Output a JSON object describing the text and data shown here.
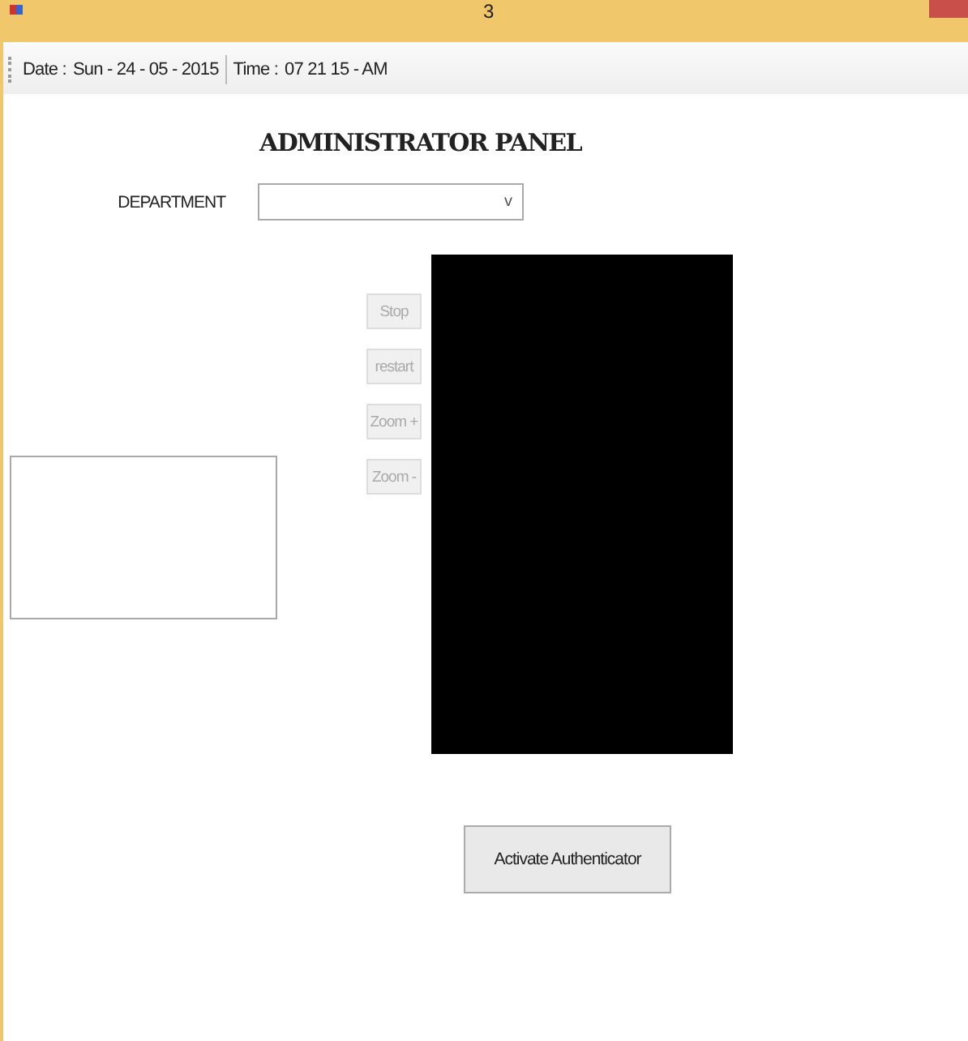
{
  "window": {
    "title": "3"
  },
  "status_bar": {
    "date_label": "Date :",
    "date": "Sun - 24 - 05 - 2015",
    "time_label": "Time :",
    "time": "07  21  15 - AM"
  },
  "heading": "ADMINISTRATOR PANEL",
  "department": {
    "label": "DEPARTMENT",
    "value_arrow": "v"
  },
  "camera_buttons": [
    {
      "label": "Stop",
      "disabled": true
    },
    {
      "label": "restart",
      "disabled": true
    },
    {
      "label": "Zoom +",
      "disabled": true
    },
    {
      "label": "Zoom -",
      "disabled": true
    }
  ],
  "activate_button": {
    "label": "Activate Authenticator",
    "disabled": false
  }
}
